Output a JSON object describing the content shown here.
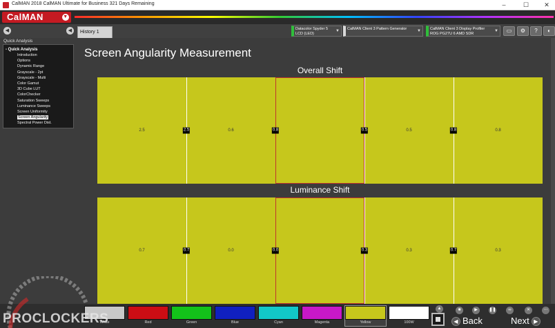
{
  "window": {
    "title": "CalMAN 2018 CalMAN Ultimate for Business 321 Days Remaining",
    "controls": {
      "minimize": "–",
      "maximize": "☐",
      "close": "✕"
    }
  },
  "logo": {
    "text": "CalMAN",
    "brand_color": "#c41a22"
  },
  "toolbar": {
    "history_tab": "History 1",
    "devices": [
      {
        "line1": "Datacolor Spyder 5",
        "line2": "LCD (LED)"
      },
      {
        "line1": "CalMAN Client 3 Pattern Generator",
        "line2": ""
      },
      {
        "line1": "CalMAN Client 3 Display Profiler",
        "line2": "ROG PG27U 6 AMD SDR"
      }
    ],
    "buttons": [
      "▭",
      "⚙",
      "?",
      "◐"
    ]
  },
  "sidebar": {
    "header": "Quick Analysis",
    "root": "- Quick Analysis",
    "items": [
      "Introduction",
      "Options",
      "Dynamic Range",
      "Grayscale - 2pt",
      "Grayscale - Multi",
      "Color Gamut",
      "3D Cube LUT",
      "ColorChecker",
      "Saturation Sweeps",
      "Luminance Sweeps",
      "Screen Uniformity",
      "Screen Angularity",
      "Spectral Power Dist."
    ],
    "selected_index": 11
  },
  "main": {
    "title": "Screen Angularity Measurement",
    "overall": {
      "title": "Overall Shift",
      "cell_values": [
        "2.5",
        "0.6",
        "",
        "0.5",
        "0.8"
      ],
      "tags": [
        "2.5",
        "0.8",
        "0.5",
        "0.8"
      ]
    },
    "luminance": {
      "title": "Luminance Shift",
      "cell_values": [
        "0.7",
        "0.0",
        "",
        "0.3",
        "0.3"
      ],
      "tags": [
        "0.7",
        "0.0",
        "0.3",
        "0.7"
      ]
    },
    "grid_color": "#c6c71c",
    "highlight_color": "#c0342c"
  },
  "bottom": {
    "swatches": [
      {
        "label": "White",
        "color": "#c8c8c8"
      },
      {
        "label": "Red",
        "color": "#cc0d14"
      },
      {
        "label": "Green",
        "color": "#13c21a"
      },
      {
        "label": "Blue",
        "color": "#1020c0"
      },
      {
        "label": "Cyan",
        "color": "#12c8c8"
      },
      {
        "label": "Magenta",
        "color": "#c818c8"
      },
      {
        "label": "Yellow",
        "color": "#c6c71c"
      },
      {
        "label": "100W",
        "color": "#ffffff"
      }
    ],
    "active_swatch": 6,
    "back_label": "Back",
    "next_label": "Next"
  },
  "watermark": "PROCLOCKERS"
}
